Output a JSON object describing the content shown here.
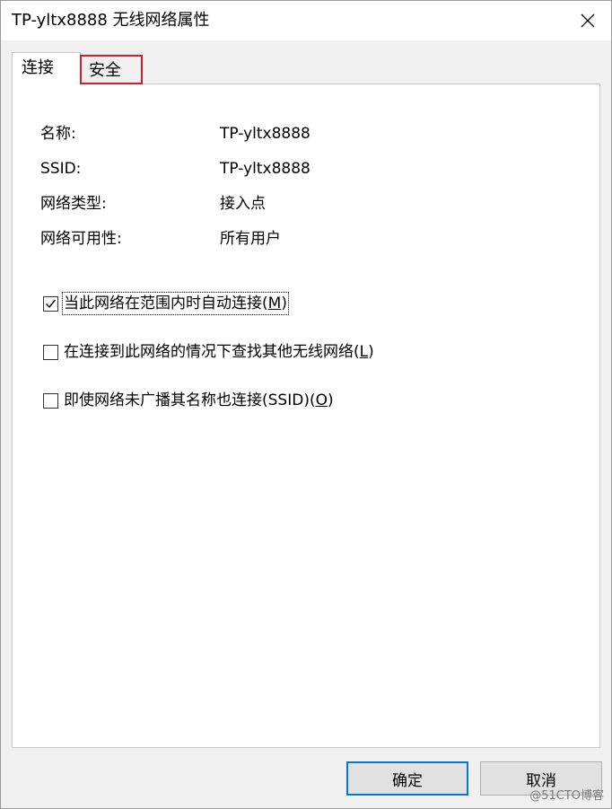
{
  "window": {
    "title": "TP-yltx8888 无线网络属性"
  },
  "tabs": [
    {
      "label": "连接",
      "selected": true
    },
    {
      "label": "安全",
      "selected": false,
      "highlighted": true
    }
  ],
  "info": [
    {
      "label": "名称:",
      "value": "TP-yltx8888"
    },
    {
      "label": "SSID:",
      "value": "TP-yltx8888"
    },
    {
      "label": "网络类型:",
      "value": "接入点"
    },
    {
      "label": "网络可用性:",
      "value": "所有用户"
    }
  ],
  "options": [
    {
      "text": "当此网络在范围内时自动连接(",
      "access_key": "M",
      "suffix": ")",
      "checked": true
    },
    {
      "text": "在连接到此网络的情况下查找其他无线网络(",
      "access_key": "L",
      "suffix": ")",
      "checked": false
    },
    {
      "text": "即使网络未广播其名称也连接(SSID)(",
      "access_key": "O",
      "suffix": ")",
      "checked": false
    }
  ],
  "buttons": {
    "ok_label": "确定",
    "cancel_label": "取消"
  },
  "watermark": "@51CTO博客",
  "colors": {
    "highlight_box": "#e01a22",
    "default_button_border": "#0078d7"
  }
}
